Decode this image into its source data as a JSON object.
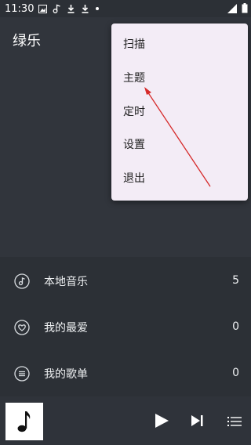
{
  "status_bar": {
    "time": "11:30"
  },
  "header": {
    "title": "绿乐"
  },
  "menu": {
    "items": [
      {
        "label": "扫描"
      },
      {
        "label": "主题"
      },
      {
        "label": "定时"
      },
      {
        "label": "设置"
      },
      {
        "label": "退出"
      }
    ]
  },
  "library": {
    "rows": [
      {
        "label": "本地音乐",
        "count": "5",
        "icon": "music-note-circle-icon"
      },
      {
        "label": "我的最爱",
        "count": "0",
        "icon": "heart-circle-icon"
      },
      {
        "label": "我的歌单",
        "count": "0",
        "icon": "list-circle-icon"
      }
    ]
  },
  "player": {
    "icons": [
      "music-note-icon",
      "play-icon",
      "skip-next-icon",
      "playlist-icon"
    ]
  },
  "colors": {
    "background": "#2c3036",
    "header": "#31353c",
    "menu_bg": "#f3ecf6",
    "annotation_arrow": "#d62a2a"
  }
}
